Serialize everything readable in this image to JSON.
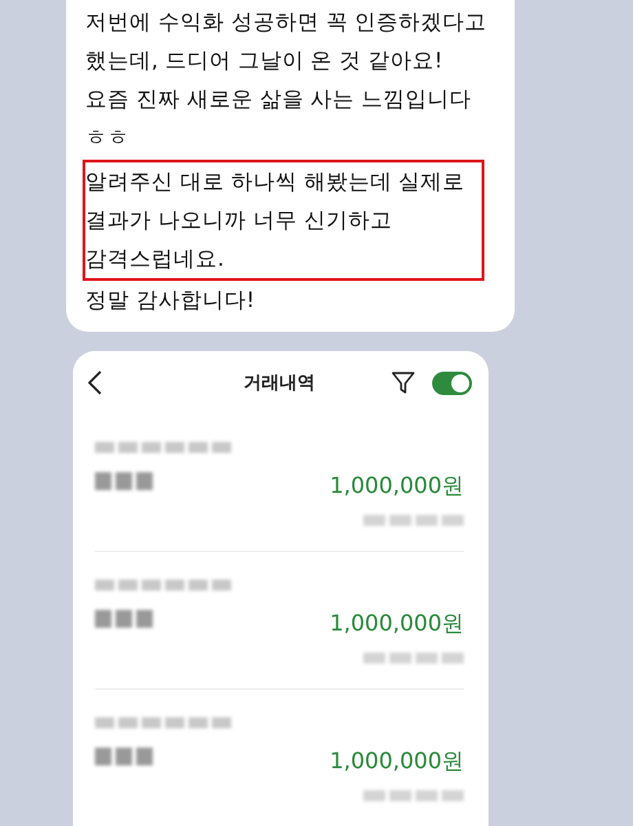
{
  "message": {
    "blocks": [
      {
        "highlighted": false,
        "lines": [
          "저번에 수익화 성공하면 꼭 인증하겠다고",
          "했는데, 드디어 그날이 온 것 같아요!",
          "요즘 진짜 새로운 삶을 사는 느낌입니다",
          "ㅎㅎ"
        ]
      },
      {
        "highlighted": true,
        "lines": [
          "알려주신 대로 하나씩 해봤는데 실제로",
          "결과가 나오니까 너무 신기하고",
          "감격스럽네요."
        ]
      },
      {
        "highlighted": false,
        "lines": [
          "정말 감사합니다!"
        ]
      }
    ]
  },
  "screen": {
    "title": "거래내역",
    "toggle": {
      "on": true
    },
    "rows": [
      {
        "amount": "1,000,000원"
      },
      {
        "amount": "1,000,000원"
      },
      {
        "amount": "1,000,000원"
      }
    ]
  }
}
